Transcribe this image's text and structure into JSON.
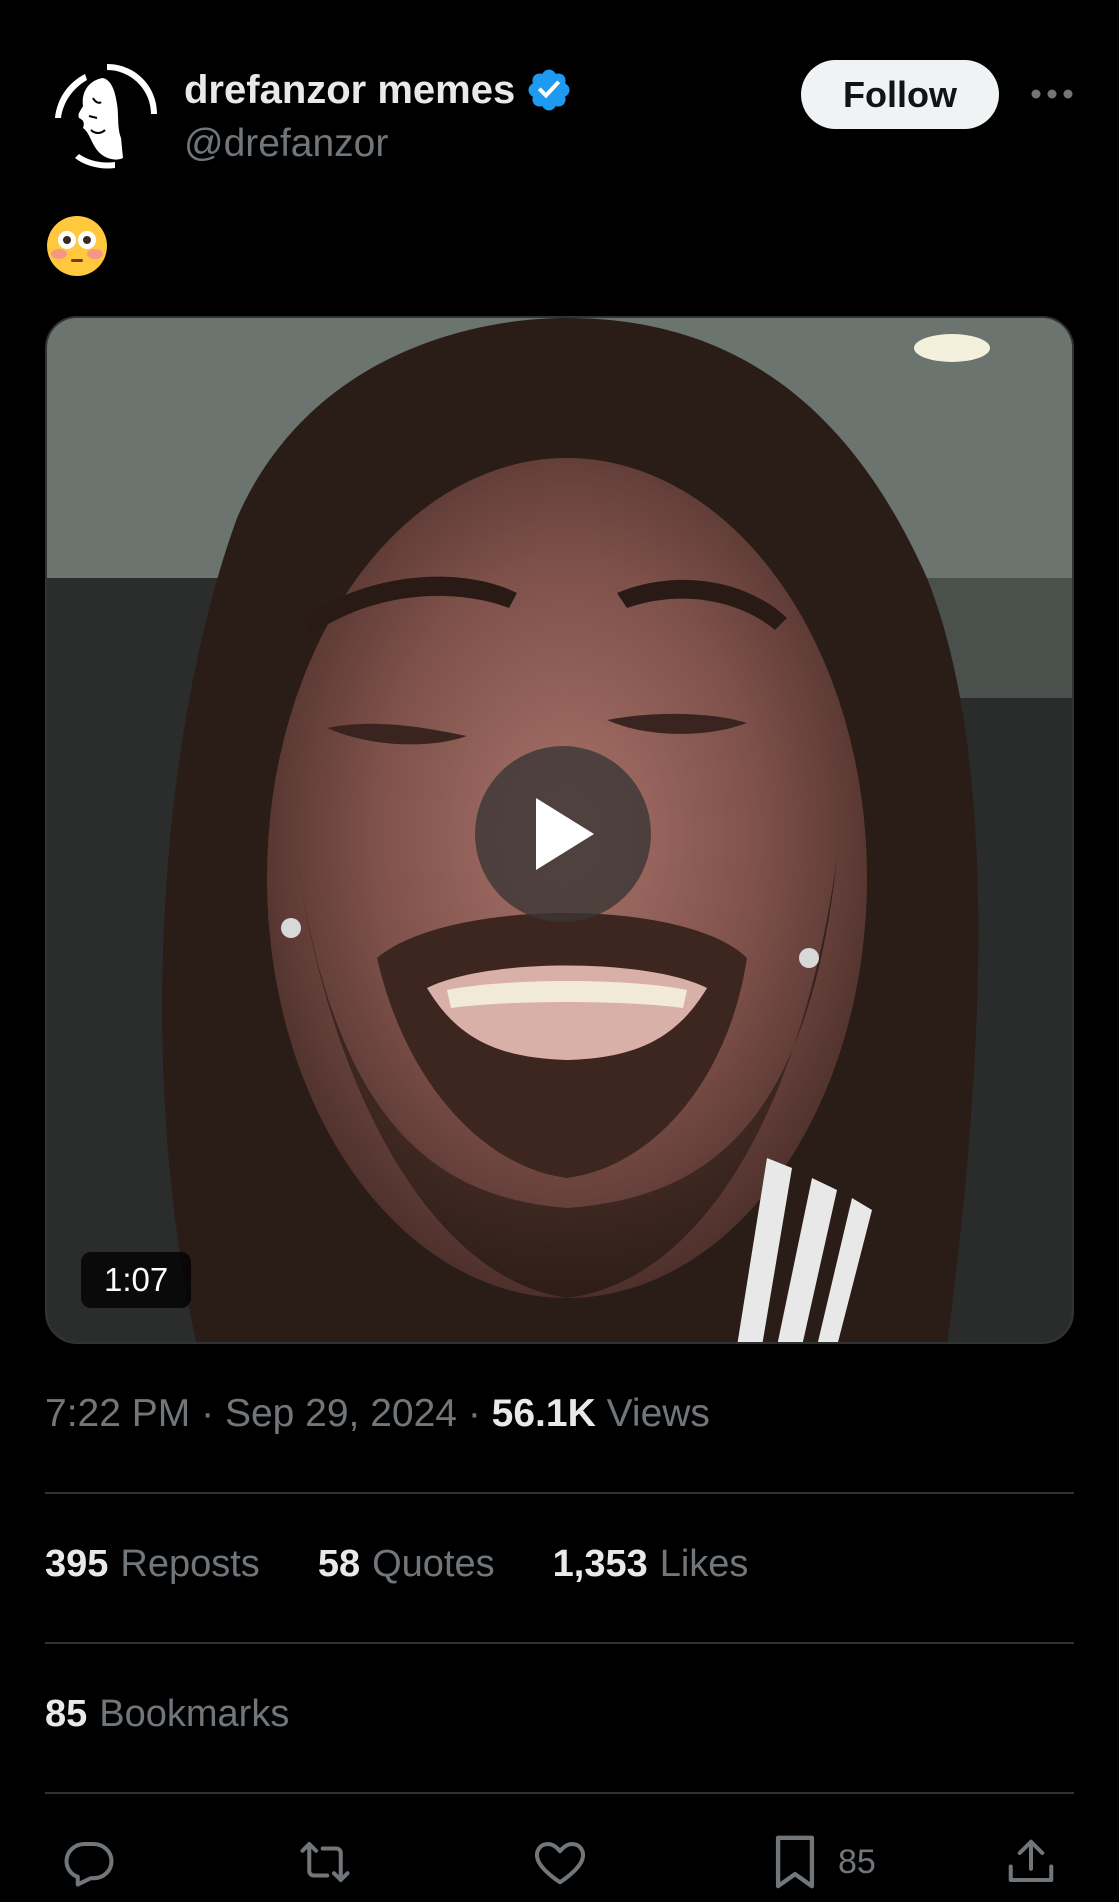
{
  "author": {
    "display_name": "drefanzor memes",
    "handle": "@drefanzor",
    "verified": true,
    "verified_color": "#1d9bf0"
  },
  "follow_label": "Follow",
  "tweet": {
    "text": "😳"
  },
  "media": {
    "type": "video",
    "duration": "1:07"
  },
  "meta": {
    "time": "7:22 PM",
    "date": "Sep 29, 2024",
    "separator": "·",
    "views_count": "56.1K",
    "views_label": "Views"
  },
  "stats": {
    "reposts_count": "395",
    "reposts_label": "Reposts",
    "quotes_count": "58",
    "quotes_label": "Quotes",
    "likes_count": "1,353",
    "likes_label": "Likes",
    "bookmarks_count": "85",
    "bookmarks_label": "Bookmarks"
  },
  "actions": {
    "bookmark_count": "85"
  },
  "colors": {
    "background": "#000000",
    "text_primary": "#e7e9ea",
    "text_secondary": "#71767b",
    "divider": "#2f3336",
    "follow_bg": "#eff3f4"
  }
}
